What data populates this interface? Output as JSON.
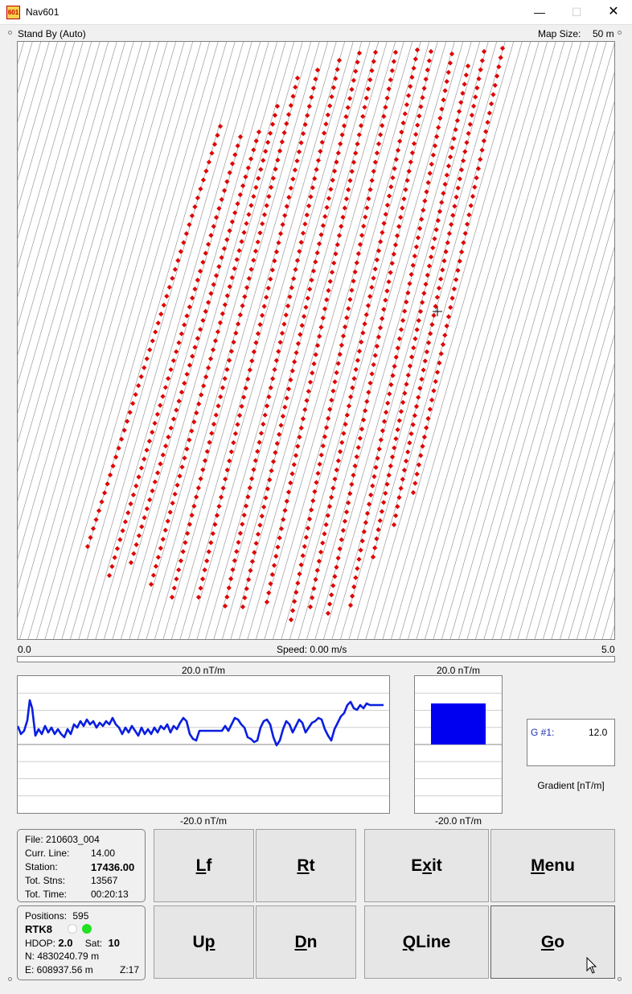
{
  "window": {
    "title": "Nav601",
    "icon_text": "601",
    "minimize_glyph": "—",
    "maximize_glyph": "☐",
    "close_glyph": "✕"
  },
  "status": {
    "mode": "Stand By (Auto)",
    "map_size_label": "Map Size:",
    "map_size_value": "50 m"
  },
  "colors": {
    "track_dots": "#e00000",
    "grid_lines": "#9a9a9a",
    "gradient_line": "#0a1ee0",
    "gradient_bar": "#0000f0",
    "status_dot_green": "#22e022"
  },
  "speed": {
    "min": "0.0",
    "max": "5.0",
    "label": "Speed:  0.00 m/s"
  },
  "gradient_plot": {
    "top_label": "20.0 nT/m",
    "bottom_label": "-20.0 nT/m"
  },
  "gradient_bar": {
    "top_label": "20.0 nT/m",
    "bottom_label": "-20.0 nT/m"
  },
  "gradient_readout": {
    "label": "G #1:",
    "value": "12.0",
    "caption": "Gradient [nT/m]"
  },
  "file_info": {
    "file": "File: 210603_004",
    "curr_line_label": "Curr. Line:",
    "curr_line_value": "14.00",
    "station_label": "Station:",
    "station_value": "17436.00",
    "tot_stns_label": "Tot. Stns:",
    "tot_stns_value": "13567",
    "tot_time_label": "Tot. Time:",
    "tot_time_value": "00:20:13"
  },
  "position_info": {
    "positions_label": "Positions:",
    "positions_value": "595",
    "fix_type": "RTK8",
    "hdop_label": "HDOP:",
    "hdop_value": "2.0",
    "sat_label": "Sat:",
    "sat_value": "10",
    "northing": "N:  4830240.79 m",
    "easting": "E:   608937.56 m",
    "zone": "Z:17"
  },
  "buttons": {
    "lf": {
      "hot": "L",
      "rest": "f"
    },
    "rt": {
      "hot": "R",
      "rest": "t"
    },
    "exit": {
      "pre": "E",
      "hot": "x",
      "rest": "it"
    },
    "menu": {
      "hot": "M",
      "rest": "enu"
    },
    "up": {
      "pre": "U",
      "hot": "p",
      "rest": ""
    },
    "dn": {
      "hot": "D",
      "rest": "n"
    },
    "qline": {
      "hot": "Q",
      "rest": "Line"
    },
    "go": {
      "hot": "G",
      "rest": "o"
    }
  }
}
